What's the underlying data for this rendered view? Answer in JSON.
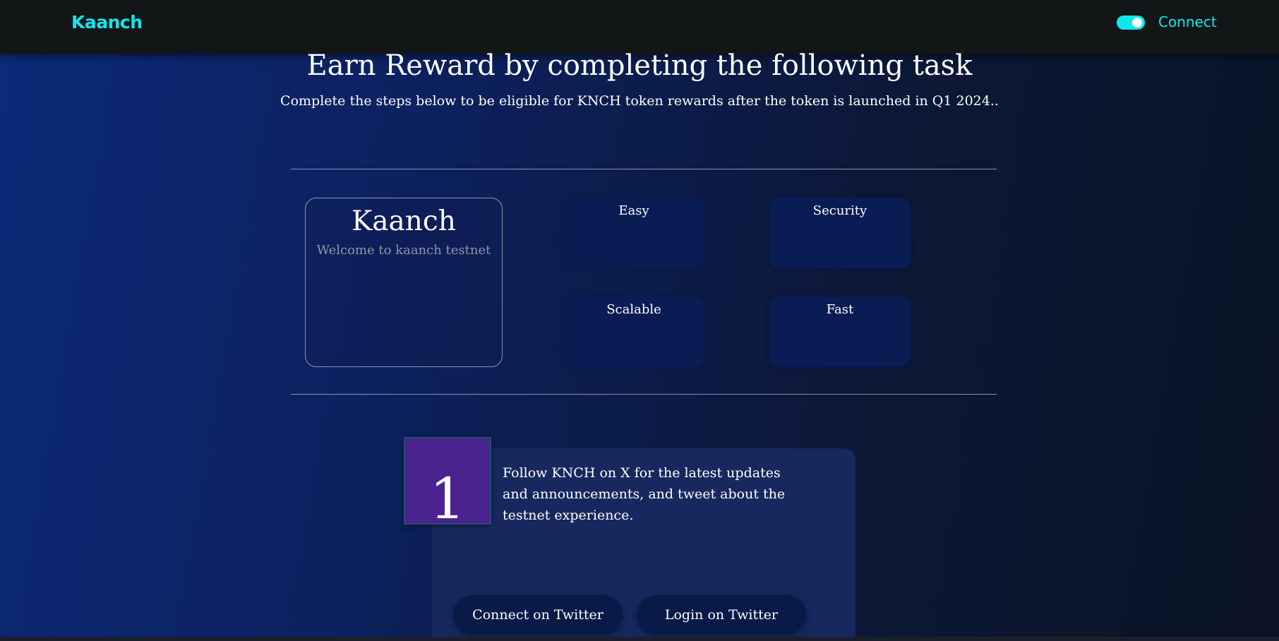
{
  "navbar": {
    "logo": "Kaanch",
    "connect_label": "Connect"
  },
  "colors": {
    "accent": "#10e6ee",
    "step_badge": "#4a238f",
    "card_bg": "#16285e",
    "feature_bg": "#0a1c54"
  },
  "hero": {
    "title": "Earn Reward by completing the following task",
    "subtitle": "Complete the steps below to be eligible for KNCH token rewards after the token is launched in Q1 2024.."
  },
  "intro_card": {
    "title": "Kaanch",
    "subtitle": "Welcome to kaanch testnet"
  },
  "features": [
    "Easy",
    "Security",
    "Scalable",
    "Fast"
  ],
  "task": {
    "number": "1",
    "description": "Follow KNCH on X for the latest updates and announcements, and tweet about the testnet experience.",
    "buttons": {
      "connect": "Connect on Twitter",
      "login": "Login on Twitter"
    }
  }
}
